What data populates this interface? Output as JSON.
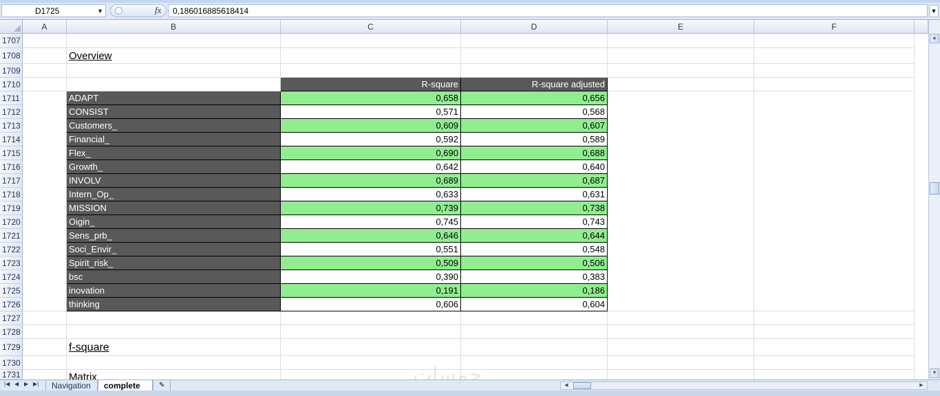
{
  "formula_bar": {
    "name_box": "D1725",
    "fx_label": "fx",
    "formula_value": "0,186016885618414"
  },
  "columns": [
    "A",
    "B",
    "C",
    "D",
    "E",
    "F"
  ],
  "rows": {
    "r1707": "1707",
    "r1708": "1708",
    "r1709": "1709",
    "r1710": "1710",
    "r1711": "1711",
    "r1712": "1712",
    "r1713": "1713",
    "r1714": "1714",
    "r1715": "1715",
    "r1716": "1716",
    "r1717": "1717",
    "r1718": "1718",
    "r1719": "1719",
    "r1720": "1720",
    "r1721": "1721",
    "r1722": "1722",
    "r1723": "1723",
    "r1724": "1724",
    "r1725": "1725",
    "r1726": "1726",
    "r1727": "1727",
    "r1728": "1728",
    "r1729": "1729",
    "r1730": "1730",
    "r1731": "1731"
  },
  "sheet": {
    "overview_title": "Overview",
    "fsquare_title": "f-square",
    "matrix_title": "Matrix",
    "table_headers": [
      "R-square",
      "R-square adjusted"
    ],
    "table_rows": [
      {
        "label": "ADAPT",
        "r2": "0,658",
        "r2adj": "0,656"
      },
      {
        "label": "CONSIST",
        "r2": "0,571",
        "r2adj": "0,568"
      },
      {
        "label": "Customers_",
        "r2": "0,609",
        "r2adj": "0,607"
      },
      {
        "label": "Financial_",
        "r2": "0,592",
        "r2adj": "0,589"
      },
      {
        "label": "Flex_",
        "r2": "0,690",
        "r2adj": "0,688"
      },
      {
        "label": "Growth_",
        "r2": "0,642",
        "r2adj": "0,640"
      },
      {
        "label": "INVOLV",
        "r2": "0,689",
        "r2adj": "0,687"
      },
      {
        "label": "Intern_Op_",
        "r2": "0,633",
        "r2adj": "0,631"
      },
      {
        "label": "MISSION",
        "r2": "0,739",
        "r2adj": "0,738"
      },
      {
        "label": "Oigin_",
        "r2": "0,745",
        "r2adj": "0,743"
      },
      {
        "label": "Sens_prb_",
        "r2": "0,646",
        "r2adj": "0,644"
      },
      {
        "label": "Soci_Envir_",
        "r2": "0,551",
        "r2adj": "0,548"
      },
      {
        "label": "Spirit_risk_",
        "r2": "0,509",
        "r2adj": "0,506"
      },
      {
        "label": "bsc",
        "r2": "0,390",
        "r2adj": "0,383"
      },
      {
        "label": "inovation",
        "r2": "0,191",
        "r2adj": "0,186"
      },
      {
        "label": "thinking",
        "r2": "0,606",
        "r2adj": "0,604"
      }
    ]
  },
  "tabs": {
    "sheet1": "Navigation",
    "sheet2": "complete"
  },
  "watermark": "خمسات",
  "colors": {
    "row_highlight": "#90ee90",
    "label_fill": "#595959"
  }
}
